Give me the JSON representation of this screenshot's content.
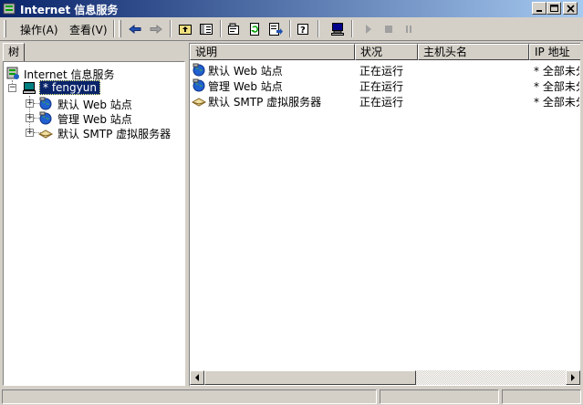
{
  "window": {
    "title": "Internet 信息服务",
    "colors": {
      "titlebar_start": "#0a246a",
      "titlebar_end": "#a6caf0",
      "selection": "#0a246a",
      "face": "#d4d0c8"
    }
  },
  "menu": {
    "action": "操作(A)",
    "view": "查看(V)"
  },
  "toolbar": {
    "icons": [
      "back-arrow-icon",
      "forward-arrow-icon",
      "up-folder-icon",
      "show-tree-icon",
      "properties-icon",
      "refresh-icon",
      "export-list-icon",
      "help-icon",
      "computer-icon",
      "play-icon",
      "stop-icon",
      "pause-icon"
    ]
  },
  "tree": {
    "tab_label": "树",
    "root": "Internet 信息服务",
    "server": "* fengyun",
    "children": [
      "默认 Web 站点",
      "管理 Web 站点",
      "默认 SMTP 虚拟服务器"
    ]
  },
  "list": {
    "columns": [
      "说明",
      "状况",
      "主机头名",
      "IP 地址"
    ],
    "rows": [
      {
        "name": "默认 Web 站点",
        "status": "正在运行",
        "host": "",
        "ip": "* 全部未分配"
      },
      {
        "name": "管理 Web 站点",
        "status": "正在运行",
        "host": "",
        "ip": "* 全部未分配"
      },
      {
        "name": "默认 SMTP 虚拟服务器",
        "status": "正在运行",
        "host": "",
        "ip": "* 全部未分配"
      }
    ]
  }
}
